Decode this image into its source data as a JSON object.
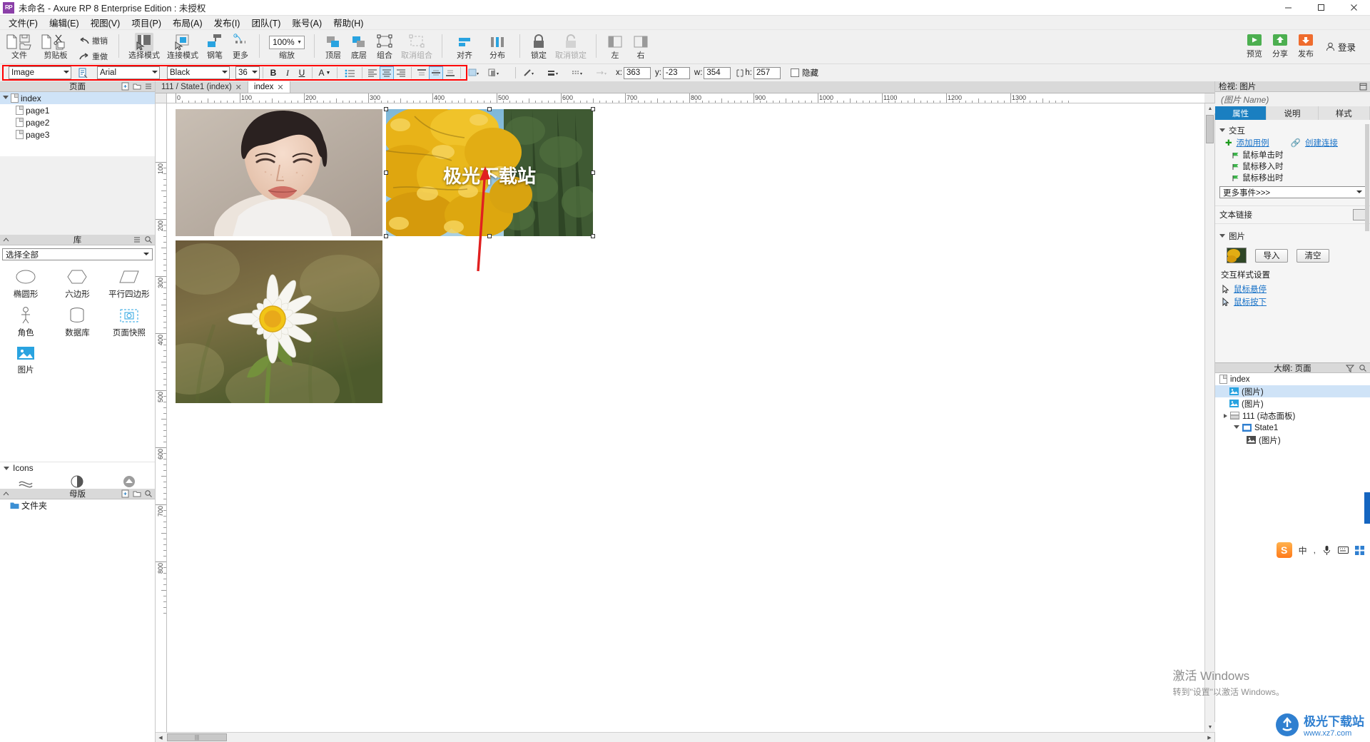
{
  "window": {
    "title": "未命名 - Axure RP 8 Enterprise Edition : 未授权",
    "logo": "RP",
    "minimize": "—",
    "maximize": "▢",
    "close": "✕"
  },
  "menu": [
    {
      "label": "文件(F)"
    },
    {
      "label": "编辑(E)"
    },
    {
      "label": "视图(V)"
    },
    {
      "label": "项目(P)"
    },
    {
      "label": "布局(A)"
    },
    {
      "label": "发布(I)"
    },
    {
      "label": "团队(T)"
    },
    {
      "label": "账号(A)"
    },
    {
      "label": "帮助(H)"
    }
  ],
  "toolbar": {
    "groups": [
      {
        "items": [
          {
            "name": "file",
            "label": "文件",
            "icon": "file-folder-icon",
            "disabled": false
          },
          {
            "name": "clipboard",
            "label": "剪贴板",
            "icon": "cut-copy-icon",
            "disabled": false
          },
          {
            "name": "undo",
            "label": "撤销",
            "icon": "undo-icon",
            "disabled": false
          },
          {
            "name": "redo",
            "label": "重做",
            "icon": "redo-icon",
            "disabled": false
          }
        ]
      },
      {
        "items": [
          {
            "name": "select-mode",
            "label": "选择模式",
            "icon": "select-mode-icon",
            "selected": true
          },
          {
            "name": "connect-mode",
            "label": "连接模式",
            "icon": "connect-mode-icon"
          },
          {
            "name": "pen",
            "label": "钢笔",
            "icon": "pen-icon"
          },
          {
            "name": "more",
            "label": "更多",
            "icon": "more-dots-icon",
            "dropdown": true
          }
        ]
      },
      {
        "items": [
          {
            "name": "zoom",
            "label": "缩放",
            "value": "100%"
          }
        ]
      },
      {
        "items": [
          {
            "name": "bring-front",
            "label": "顶层",
            "icon": "bring-front-icon"
          },
          {
            "name": "send-back",
            "label": "底层",
            "icon": "send-back-icon"
          },
          {
            "name": "group",
            "label": "组合",
            "icon": "group-icon"
          },
          {
            "name": "ungroup",
            "label": "取消组合",
            "icon": "ungroup-icon",
            "disabled": true
          }
        ]
      },
      {
        "items": [
          {
            "name": "align",
            "label": "对齐",
            "icon": "align-icon",
            "dropdown": true
          },
          {
            "name": "distribute",
            "label": "分布",
            "icon": "distribute-icon",
            "dropdown": true
          }
        ]
      },
      {
        "items": [
          {
            "name": "lock",
            "label": "锁定",
            "icon": "lock-icon"
          },
          {
            "name": "unlock",
            "label": "取消锁定",
            "icon": "unlock-icon",
            "disabled": true
          }
        ]
      },
      {
        "items": [
          {
            "name": "left",
            "label": "左",
            "icon": "panel-left-icon"
          },
          {
            "name": "right",
            "label": "右",
            "icon": "panel-right-icon"
          }
        ]
      }
    ],
    "right": [
      {
        "name": "preview",
        "label": "预览",
        "icon": "preview-icon"
      },
      {
        "name": "share",
        "label": "分享",
        "icon": "share-icon"
      },
      {
        "name": "publish",
        "label": "发布",
        "icon": "publish-icon",
        "dropdown": true
      }
    ],
    "login": "登录"
  },
  "stylebar": {
    "widget_type": "Image",
    "font_family": "Arial",
    "font_color_name": "Black",
    "font_size": "36",
    "bold": "B",
    "italic": "I",
    "underline": "U",
    "font_color_icon": "A",
    "list_icon": "bullet-list-icon",
    "align_left": "align-left-icon",
    "align_center": "align-center-icon",
    "align_right": "align-right-icon",
    "valign_top": "valign-top-icon",
    "valign_middle": "valign-middle-icon",
    "valign_bottom": "valign-bottom-icon",
    "fill": "fill-color-icon",
    "shadow": "shadow-icon",
    "border_color": "border-color-icon",
    "border_width": "border-width-icon",
    "border_style": "border-style-icon",
    "arrow_style": "arrow-style-icon",
    "coords": {
      "x_label": "x:",
      "x_value": "363",
      "y_label": "y:",
      "y_value": "-23",
      "w_label": "w:",
      "w_value": "354",
      "h_label": "h:",
      "h_value": "257",
      "h_icon": "lock-ratio-icon"
    },
    "hidden_label": "隐藏",
    "hidden_checked": false
  },
  "left": {
    "pages_panel": {
      "title": "页面",
      "icons": [
        "add-page-icon",
        "add-folder-icon",
        "menu-icon"
      ],
      "tree": [
        {
          "label": "index",
          "level": 0,
          "selected": true,
          "expanded": true
        },
        {
          "label": "page1",
          "level": 1,
          "selected": false
        },
        {
          "label": "page2",
          "level": 1,
          "selected": false
        },
        {
          "label": "page3",
          "level": 1,
          "selected": false
        }
      ]
    },
    "library_panel": {
      "title": "库",
      "icons_left": [
        "collapse-icon"
      ],
      "icons_right": [
        "menu-icon",
        "search-icon"
      ],
      "dropdown_value": "选择全部",
      "items": [
        {
          "label": "椭圆形",
          "icon": "ellipse-icon"
        },
        {
          "label": "六边形",
          "icon": "hexagon-icon"
        },
        {
          "label": "平行四边形",
          "icon": "parallelogram-icon"
        },
        {
          "label": "角色",
          "icon": "person-icon"
        },
        {
          "label": "数据库",
          "icon": "database-icon"
        },
        {
          "label": "页面快照",
          "icon": "snapshot-icon"
        },
        {
          "label": "图片",
          "icon": "image-icon"
        }
      ],
      "section_label": "Icons",
      "section_icons": [
        "flag-icon",
        "contrast-icon",
        "arrow-up-icon"
      ]
    },
    "masters_panel": {
      "title": "母版",
      "icons_left": [
        "collapse-icon"
      ],
      "icons_right": [
        "add-icon",
        "add-folder-icon",
        "search-icon"
      ],
      "items": [
        {
          "label": "文件夹",
          "icon": "folder-icon"
        }
      ]
    }
  },
  "canvas": {
    "tabs": [
      {
        "label": "111 / State1 (index)",
        "active": false,
        "closable": true
      },
      {
        "label": "index",
        "active": true,
        "closable": true
      }
    ],
    "h_ruler_labels": [
      "0",
      "100",
      "200",
      "300",
      "400",
      "500",
      "600",
      "700",
      "800",
      "900",
      "1000",
      "1100",
      "1200",
      "1300"
    ],
    "v_ruler_labels": [
      "100",
      "200",
      "300",
      "400",
      "500",
      "600",
      "700",
      "800"
    ],
    "overlay_text": "极光下载站",
    "images": [
      {
        "name": "portrait-image",
        "alt": "女性肖像照片"
      },
      {
        "name": "ginkgo-image",
        "alt": "黄色银杏树叶照片",
        "selected": true
      },
      {
        "name": "daisy-image",
        "alt": "白色雏菊花朵照片"
      }
    ]
  },
  "right": {
    "inspector": {
      "title": "检视: 图片",
      "name_placeholder": "(图片 Name)",
      "tabs": [
        {
          "label": "属性",
          "active": true
        },
        {
          "label": "说明",
          "active": false
        },
        {
          "label": "样式",
          "active": false
        }
      ],
      "interactions": {
        "section": "交互",
        "add_case": "添加用例",
        "create_link": "创建连接",
        "events": [
          "鼠标单击时",
          "鼠标移入时",
          "鼠标移出时"
        ],
        "more_events": "更多事件>>>"
      },
      "text_link": {
        "label": "文本链接"
      },
      "image_section": {
        "section": "图片",
        "import_btn": "导入",
        "clear_btn": "清空",
        "style_label": "交互样式设置",
        "hover": "鼠标悬停",
        "mousedown": "鼠标按下"
      }
    },
    "outline": {
      "title": "大纲: 页面",
      "icons": [
        "filter-icon",
        "search-icon"
      ],
      "tree": [
        {
          "label": "index",
          "level": 0,
          "icon": "page-icon",
          "selected": false
        },
        {
          "label": "(图片)",
          "level": 1,
          "icon": "image-icon",
          "selected": true
        },
        {
          "label": "(图片)",
          "level": 1,
          "icon": "image-icon",
          "selected": false
        },
        {
          "label": "111 (动态面板)",
          "level": 1,
          "icon": "panel-icon",
          "selected": false,
          "expanded": true
        },
        {
          "label": "State1",
          "level": 2,
          "icon": "state-icon",
          "selected": false,
          "expanded": true
        },
        {
          "label": "(图片)",
          "level": 3,
          "icon": "image-icon",
          "selected": false
        }
      ]
    }
  },
  "watermark": {
    "line1": "激活 Windows",
    "line2": "转到\"设置\"以激活 Windows。"
  },
  "brand": {
    "name": "极光下载站",
    "url": "www.xz7.com",
    "mark": "S"
  },
  "tray": {
    "ime_mode": "中",
    "items": [
      "comma-icon",
      "mic-icon",
      "keyboard-icon",
      "grid-icon"
    ]
  },
  "colors": {
    "accent": "#1a7fc1",
    "selection": "#cfe3f7",
    "redbox": "#ff0000",
    "arrow_red": "#e02020",
    "icon_blue": "#29a3e0"
  }
}
